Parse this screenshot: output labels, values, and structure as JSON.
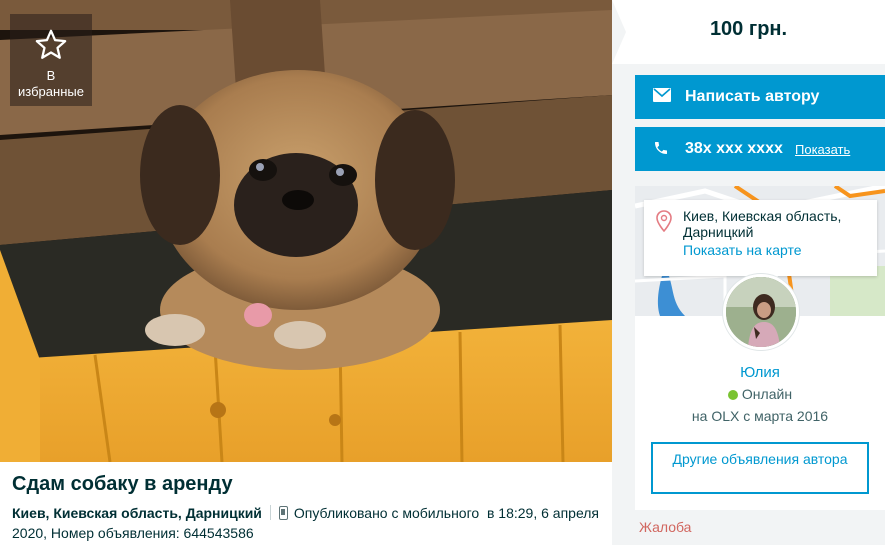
{
  "photo": {
    "favorite_label_line1": "В",
    "favorite_label_line2": "избранные",
    "favorite_icon": "star-icon"
  },
  "ad": {
    "title": "Сдам собаку в аренду",
    "location": "Киев, Киевская область, Дарницкий",
    "published": "Опубликовано с мобильного",
    "date": "в 18:29, 6 апреля 2020, Номер объявления: 644543586"
  },
  "sidebar": {
    "price": "100 грн.",
    "write_button_label": "Написать автору",
    "write_icon": "envelope-icon",
    "phone_number": "38x xxx xxxx",
    "phone_show_label": "Показать",
    "phone_icon": "phone-icon",
    "address_line": "Киев, Киевская область, Дарницкий",
    "map_link": "Показать на карте",
    "seller_name": "Юлия",
    "online_label": "Онлайн",
    "member_since": "на OLX с марта 2016",
    "other_ads_label": "Другие объявления автора",
    "complaint_label": "Жалоба"
  },
  "colors": {
    "accent": "#0098d0",
    "online": "#7ac331",
    "complaint": "#d1665f",
    "text": "#002f34"
  }
}
